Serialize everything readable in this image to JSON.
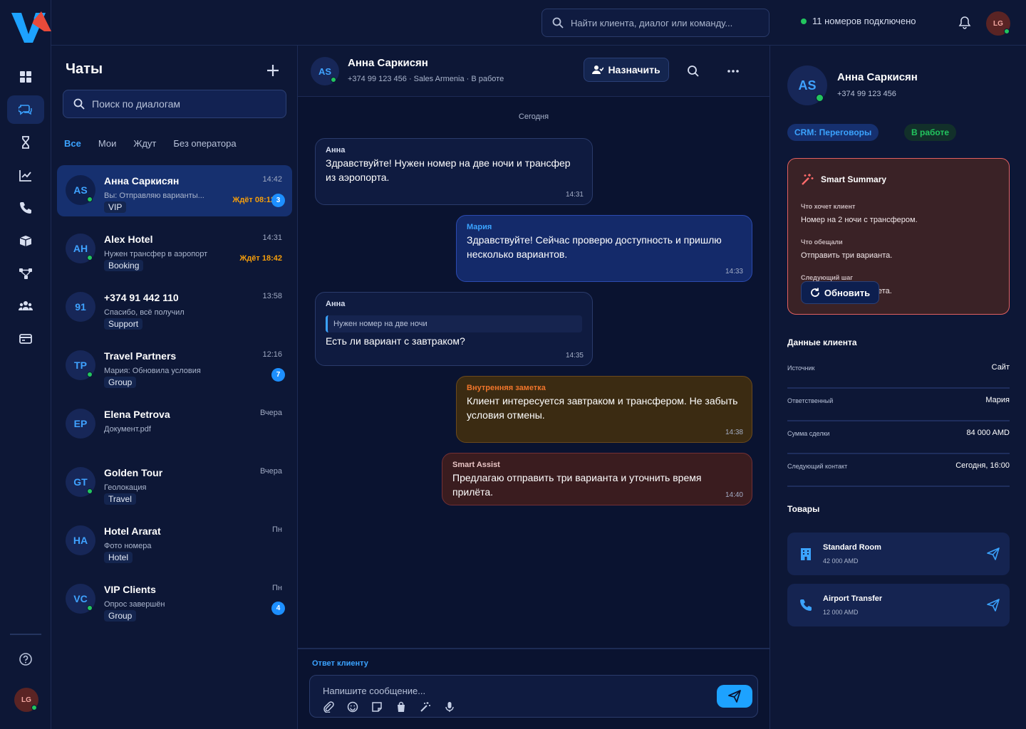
{
  "topbar": {
    "search_placeholder": "Найти клиента, диалог или команду...",
    "connection_status": "11 номеров подключено",
    "user_initials": "LG"
  },
  "rail": {
    "items": [
      "dashboard-icon",
      "chats-icon",
      "hourglass-icon",
      "analytics-icon",
      "phone-icon",
      "box-icon",
      "flow-icon",
      "team-icon",
      "billing-icon"
    ],
    "help_icon": "help-icon",
    "user_initials": "LG"
  },
  "chats": {
    "title": "Чаты",
    "search_placeholder": "Поиск по диалогам",
    "tabs": [
      "Все",
      "Мои",
      "Ждут",
      "Без оператора"
    ],
    "items": [
      {
        "initials": "AS",
        "name": "Анна Саркисян",
        "time": "14:42",
        "preview": "Вы: Отправляю варианты...",
        "tag": "VIP",
        "wait": "Ждёт 08:12",
        "badge": "3",
        "online": true
      },
      {
        "initials": "AH",
        "name": "Alex Hotel",
        "time": "14:31",
        "preview": "Нужен трансфер в аэропорт",
        "tag": "Booking",
        "wait": "Ждёт 18:42",
        "badge": "",
        "online": true
      },
      {
        "initials": "91",
        "name": "+374 91 442 110",
        "time": "13:58",
        "preview": "Спасибо, всё получил",
        "tag": "Support",
        "wait": "",
        "badge": "",
        "online": false
      },
      {
        "initials": "TP",
        "name": "Travel Partners",
        "time": "12:16",
        "preview": "Мария: Обновила условия",
        "tag": "Group",
        "wait": "",
        "badge": "7",
        "online": true
      },
      {
        "initials": "EP",
        "name": "Elena Petrova",
        "time": "Вчера",
        "preview": "Документ.pdf",
        "tag": "",
        "wait": "",
        "badge": "",
        "online": false
      },
      {
        "initials": "GT",
        "name": "Golden Tour",
        "time": "Вчера",
        "preview": "Геолокация",
        "tag": "Travel",
        "wait": "",
        "badge": "",
        "online": true
      },
      {
        "initials": "HA",
        "name": "Hotel Ararat",
        "time": "Пн",
        "preview": "Фото номера",
        "tag": "Hotel",
        "wait": "",
        "badge": "",
        "online": false
      },
      {
        "initials": "VC",
        "name": "VIP Clients",
        "time": "Пн",
        "preview": "Опрос завершён",
        "tag": "Group",
        "wait": "",
        "badge": "4",
        "online": true
      }
    ]
  },
  "conversation": {
    "initials": "AS",
    "name": "Анна Саркисян",
    "subtitle": "+374 99 123 456 · Sales Armenia · В работе",
    "assign_label": "Назначить",
    "day_label": "Сегодня",
    "messages": [
      {
        "author": "Анна",
        "text": "Здравствуйте! Нужен номер на две ночи и трансфер из аэропорта.",
        "time": "14:31"
      },
      {
        "author": "Мария",
        "text": "Здравствуйте! Сейчас проверю доступность и пришлю несколько вариантов.",
        "time": "14:33"
      },
      {
        "author": "Анна",
        "quote": "Нужен номер на две ночи",
        "text": "Есть ли вариант с завтраком?",
        "time": "14:35"
      },
      {
        "author": "Внутренняя заметка",
        "text": "Клиент интересуется завтраком и трансфером. Не забыть условия отмены.",
        "time": "14:38"
      },
      {
        "author": "Smart Assist",
        "text": "Предлагаю отправить три варианта и уточнить время прилёта.",
        "time": "14:40"
      }
    ],
    "composer_label": "Ответ клиенту",
    "composer_placeholder": "Напишите сообщение..."
  },
  "client": {
    "initials": "AS",
    "name": "Анна Саркисян",
    "phone": "+374 99 123 456",
    "crm_pill": "CRM: Переговоры",
    "status_pill": "В работе",
    "summary": {
      "title": "Smart Summary",
      "wants_label": "Что хочет клиент",
      "wants_value": "Номер на 2 ночи с трансфером.",
      "promised_label": "Что обещали",
      "promised_value": "Отправить три варианта.",
      "next_label": "Следующий шаг",
      "next_value_tail": "ета.",
      "refresh_label": "Обновить"
    },
    "data_title": "Данные клиента",
    "fields": [
      {
        "key": "Источник",
        "value": "Сайт"
      },
      {
        "key": "Ответственный",
        "value": "Мария"
      },
      {
        "key": "Сумма сделки",
        "value": "84 000 AMD"
      },
      {
        "key": "Следующий контакт",
        "value": "Сегодня, 16:00"
      }
    ],
    "products_title": "Товары",
    "products": [
      {
        "name": "Standard Room",
        "price": "42 000 AMD",
        "icon": "building-icon"
      },
      {
        "name": "Airport Transfer",
        "price": "12 000 AMD",
        "icon": "phone-icon"
      }
    ]
  },
  "colors": {
    "accent": "#1da2ff",
    "online": "#22c55e",
    "wait": "#f59e0b",
    "note": "#f0752b",
    "summary_border": "#e26060"
  }
}
